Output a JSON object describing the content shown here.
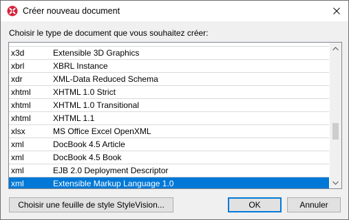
{
  "window": {
    "title": "Créer nouveau document",
    "close_icon": "close-icon"
  },
  "prompt": "Choisir le type de document que vous souhaitez créer:",
  "list": {
    "items": [
      {
        "ext": "x3d",
        "desc": "Extensible 3D Graphics"
      },
      {
        "ext": "xbrl",
        "desc": "XBRL Instance"
      },
      {
        "ext": "xdr",
        "desc": "XML-Data Reduced Schema"
      },
      {
        "ext": "xhtml",
        "desc": "XHTML 1.0 Strict"
      },
      {
        "ext": "xhtml",
        "desc": "XHTML 1.0 Transitional"
      },
      {
        "ext": "xhtml",
        "desc": "XHTML 1.1"
      },
      {
        "ext": "xlsx",
        "desc": "MS Office Excel OpenXML"
      },
      {
        "ext": "xml",
        "desc": "DocBook 4.5 Article"
      },
      {
        "ext": "xml",
        "desc": "DocBook 4.5 Book"
      },
      {
        "ext": "xml",
        "desc": "EJB 2.0 Deployment Descriptor"
      },
      {
        "ext": "xml",
        "desc": "Extensible Markup Language 1.0"
      }
    ],
    "selected_index": 10,
    "scroll_position": 0.72
  },
  "buttons": {
    "stylevision": "Choisir une feuille de style StyleVision...",
    "ok": "OK",
    "cancel": "Annuler"
  },
  "colors": {
    "selection": "#0078d7",
    "app_icon": "#d9213a",
    "default_button_border": "#0078d7"
  }
}
